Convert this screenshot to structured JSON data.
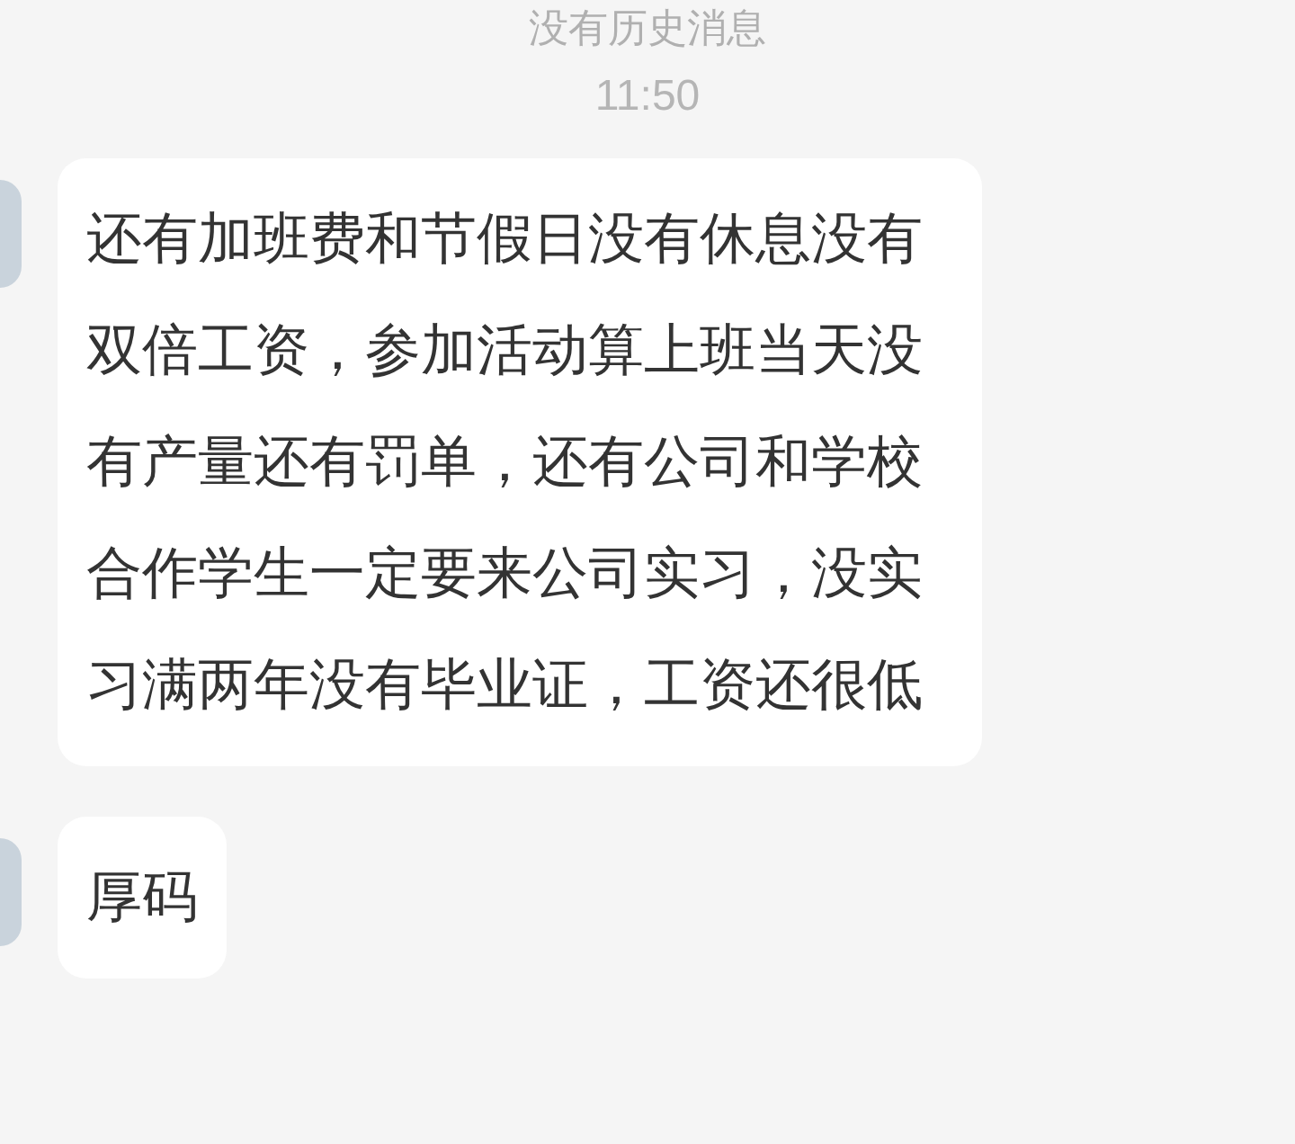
{
  "notice": "没有历史消息",
  "timestamp": "11:50",
  "messages": [
    {
      "text": "还有加班费和节假日没有休息没有双倍工资，参加活动算上班当天没有产量还有罚单，还有公司和学校合作学生一定要来公司实习，没实习满两年没有毕业证，工资还很低"
    },
    {
      "text": "厚码"
    }
  ]
}
